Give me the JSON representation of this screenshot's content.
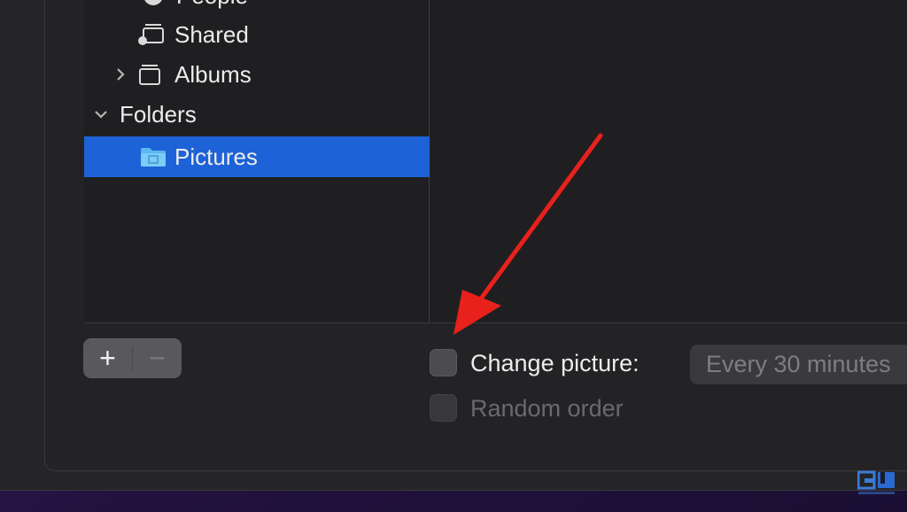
{
  "sidebar": {
    "items": [
      {
        "label": "People",
        "icon": "person-circle-icon",
        "expandable": false
      },
      {
        "label": "Shared",
        "icon": "shared-album-icon",
        "expandable": false
      },
      {
        "label": "Albums",
        "icon": "albums-stack-icon",
        "expandable": true,
        "expanded": false
      },
      {
        "label": "Folders",
        "icon": "chevron-down-icon",
        "expandable": true,
        "expanded": true
      },
      {
        "label": "Pictures",
        "icon": "folder-icon",
        "selected": true
      }
    ]
  },
  "toolbar": {
    "add_label": "+",
    "remove_label": "−"
  },
  "options": {
    "change_picture_label": "Change picture:",
    "change_picture_checked": false,
    "interval_value": "Every 30 minutes",
    "random_order_label": "Random order",
    "random_order_checked": false,
    "random_order_enabled": false
  },
  "annotation": {
    "arrow_color": "#e8211c"
  },
  "colors": {
    "selection": "#1d62d6",
    "window_bg": "#252528",
    "pane_bg": "#1f1f22"
  }
}
